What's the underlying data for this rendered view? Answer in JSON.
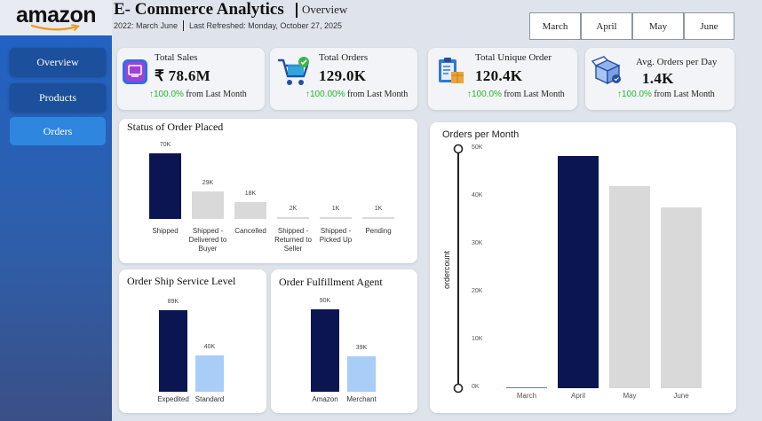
{
  "logo": {
    "text": "amazon"
  },
  "header": {
    "title": "E- Commerce Analytics",
    "subtitle": "Overview",
    "period": "2022: March   June",
    "last_refreshed": "Last Refreshed: Monday, October 27, 2025"
  },
  "months": [
    "March",
    "April",
    "May",
    "June"
  ],
  "nav": {
    "overview": "Overview",
    "products": "Products",
    "orders": "Orders"
  },
  "kpis": [
    {
      "label": "Total Sales",
      "value": "₹ 78.6M",
      "change": "↑100.0%",
      "suffix": " from Last Month"
    },
    {
      "label": "Total Orders",
      "value": "129.0K",
      "change": "↑100.00%",
      "suffix": " from Last Month"
    },
    {
      "label": "Total Unique Order",
      "value": "120.4K",
      "change": "↑100.0%",
      "suffix": " from Last Month"
    },
    {
      "label": "Avg. Orders per Day",
      "value": "1.4K",
      "change": "↑100.0%",
      "suffix": " from Last Month"
    }
  ],
  "colors": {
    "dark": "#0b1552",
    "light_gray": "#d9d9d9",
    "light_blue": "#a8cdf7",
    "green": "#1fb82b"
  },
  "chart_data": [
    {
      "type": "bar",
      "title": "Status of Order Placed",
      "categories": [
        "Shipped",
        "Shipped - Delivered to Buyer",
        "Cancelled",
        "Shipped - Returned to Seller",
        "Shipped - Picked Up",
        "Pending"
      ],
      "category_lines": [
        [
          "Shipped"
        ],
        [
          "Shipped -",
          "Delivered to",
          "Buyer"
        ],
        [
          "Cancelled"
        ],
        [
          "Shipped -",
          "Returned to",
          "Seller"
        ],
        [
          "Shipped -",
          "Picked Up"
        ],
        [
          "Pending"
        ]
      ],
      "values": [
        70000,
        29000,
        18000,
        2000,
        1000,
        1000
      ],
      "labels": [
        "70K",
        "29K",
        "18K",
        "2K",
        "1K",
        "1K"
      ],
      "highlight_index": 0
    },
    {
      "type": "bar",
      "title": "Order Ship Service Level",
      "categories": [
        "Expedited",
        "Standard"
      ],
      "values": [
        89000,
        40000
      ],
      "labels": [
        "89K",
        "40K"
      ]
    },
    {
      "type": "bar",
      "title": "Order Fulfillment Agent",
      "categories": [
        "Amazon",
        "Merchant"
      ],
      "values": [
        90000,
        39000
      ],
      "labels": [
        "90K",
        "39K"
      ]
    },
    {
      "type": "bar",
      "title": "Orders per Month",
      "categories": [
        "March",
        "April",
        "May",
        "June"
      ],
      "values": [
        200,
        48500,
        42200,
        37700
      ],
      "ylabel": "ordercount",
      "yticks": [
        "0K",
        "10K",
        "20K",
        "30K",
        "40K",
        "50K"
      ],
      "ylim": [
        0,
        50000
      ],
      "highlight_index": 1
    }
  ]
}
